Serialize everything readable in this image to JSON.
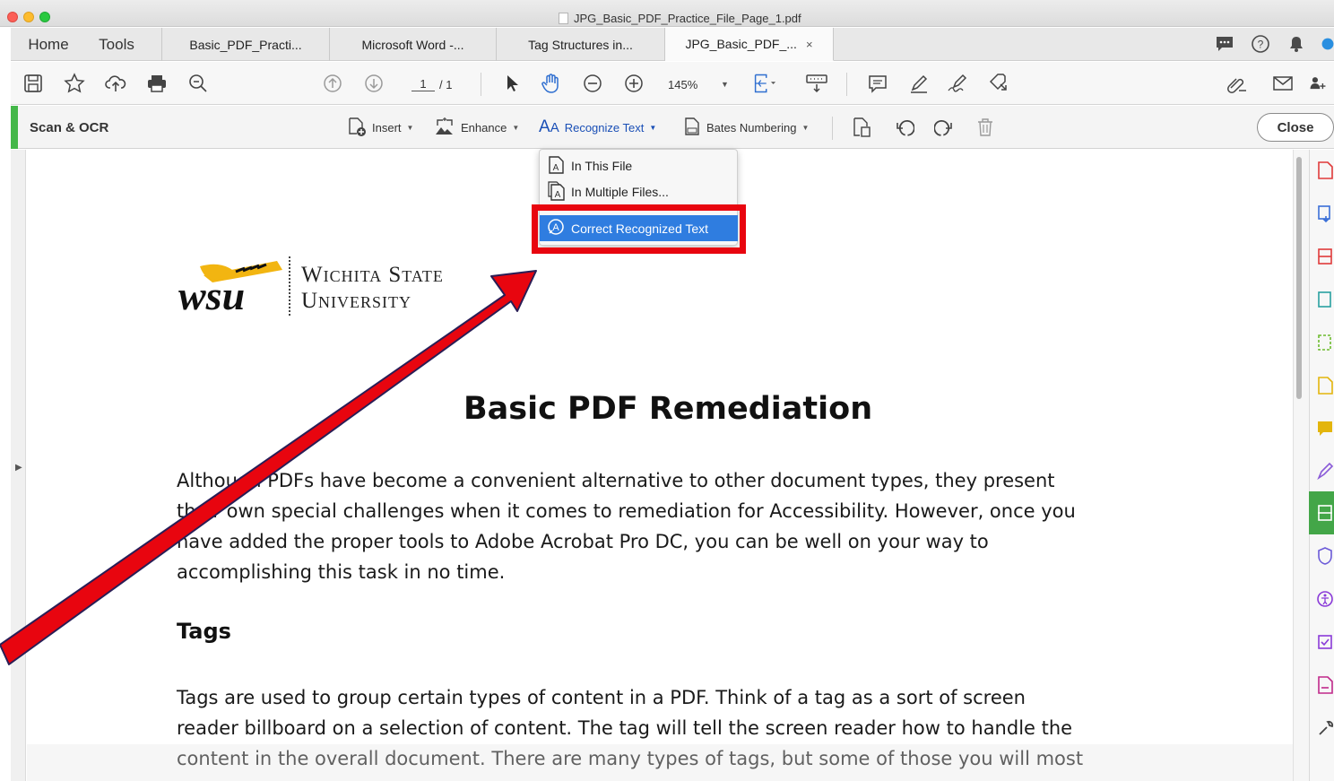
{
  "window": {
    "title": "JPG_Basic_PDF_Practice_File_Page_1.pdf"
  },
  "tabs": {
    "home": "Home",
    "tools": "Tools",
    "docs": [
      {
        "label": "Basic_PDF_Practi..."
      },
      {
        "label": "Microsoft Word -..."
      },
      {
        "label": "Tag Structures in..."
      },
      {
        "label": "JPG_Basic_PDF_...",
        "close": "×"
      }
    ]
  },
  "toolbar": {
    "page_current": "1",
    "page_total": "/ 1",
    "zoom": "145%"
  },
  "ocr_bar": {
    "title": "Scan & OCR",
    "insert": "Insert",
    "enhance": "Enhance",
    "recognize_text": "Recognize Text",
    "bates": "Bates Numbering",
    "close": "Close"
  },
  "dropdown": {
    "in_this_file": "In This File",
    "in_multiple_files": "In Multiple Files...",
    "correct_recognized_text": "Correct Recognized Text"
  },
  "document": {
    "logo_text_line1": "Wichita State",
    "logo_text_line2": "University",
    "logo_mark": "wsu",
    "heading": "Basic PDF Remediation",
    "para1": [
      "Although PDFs have become a convenient alternative to other document types, they present",
      "their own special challenges when it comes to remediation for Accessibility. However, once you",
      "have added the proper tools to Adobe Acrobat Pro DC, you can be well on your way to",
      "accomplishing this task in no time."
    ],
    "tags_heading": "Tags",
    "para2": [
      "Tags are used to group certain types of content in a PDF. Think of a tag as a sort of screen",
      "reader billboard on a selection of content. The tag will tell the screen reader how to handle the",
      "content in the overall document. There are many types of tags, but some of those you will most"
    ]
  },
  "colors": {
    "accent_green": "#44b749",
    "menu_highlight": "#2f7de0",
    "annotation_red": "#e8050f",
    "link_blue": "#1a4fb6"
  }
}
